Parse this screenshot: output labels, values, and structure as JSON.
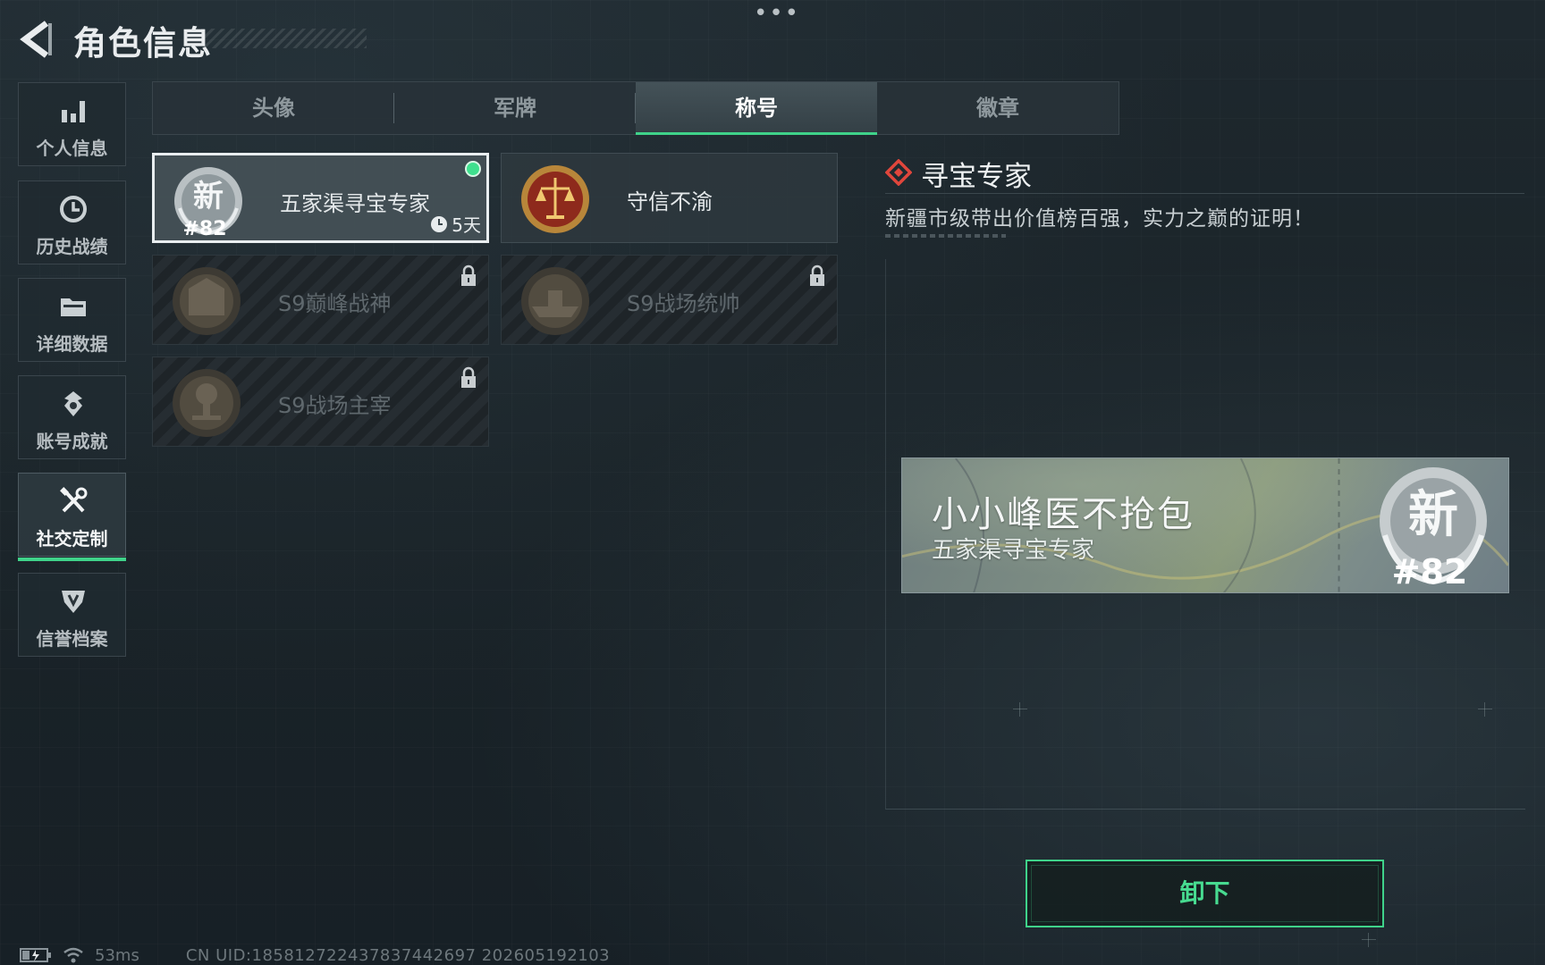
{
  "header": {
    "more_dots": "•••",
    "title": "角色信息"
  },
  "sidebar": {
    "items": [
      {
        "label": "个人信息",
        "icon": "bar-chart-icon"
      },
      {
        "label": "历史战绩",
        "icon": "history-clock-icon"
      },
      {
        "label": "详细数据",
        "icon": "folder-icon"
      },
      {
        "label": "账号成就",
        "icon": "achievement-icon"
      },
      {
        "label": "社交定制",
        "icon": "tools-icon",
        "active": true
      },
      {
        "label": "信誉档案",
        "icon": "credit-shield-icon"
      }
    ]
  },
  "tabs": [
    {
      "label": "头像"
    },
    {
      "label": "军牌"
    },
    {
      "label": "称号",
      "active": true
    },
    {
      "label": "徽章"
    }
  ],
  "titles": [
    {
      "name": "五家渠寻宝专家",
      "badge_number": "#82",
      "badge_char": "新",
      "timer": "5天",
      "selected": true,
      "equipped": true
    },
    {
      "name": "守信不渝",
      "locked": false
    },
    {
      "name": "S9巅峰战神",
      "locked": true
    },
    {
      "name": "S9战场统帅",
      "locked": true
    },
    {
      "name": "S9战场主宰",
      "locked": true
    }
  ],
  "detail": {
    "title": "寻宝专家",
    "description": "新疆市级带出价值榜百强，实力之巅的证明！"
  },
  "preview": {
    "player_name": "小小峰医不抢包",
    "title": "五家渠寻宝专家",
    "badge_char": "新",
    "badge_number": "#82"
  },
  "actions": {
    "unequip_label": "卸下"
  },
  "status": {
    "ping": "53ms",
    "uid": "CN UID:18581272243783744269​7 202605192103"
  },
  "colors": {
    "accent": "#3fd38a",
    "diamond": "#e0463c"
  }
}
